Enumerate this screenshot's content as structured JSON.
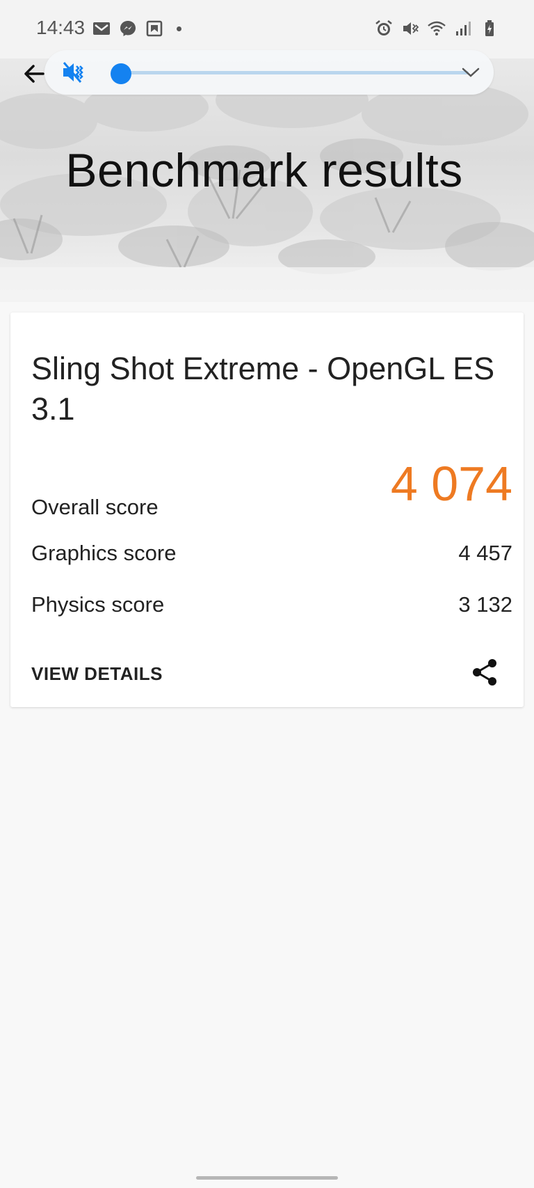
{
  "status_bar": {
    "time": "14:43",
    "left_icons": [
      "gmail-icon",
      "messenger-icon",
      "image-app-icon",
      "more-notifications-dot"
    ],
    "right_icons": [
      "alarm-icon",
      "vibrate-icon",
      "wifi-icon",
      "signal-icon",
      "battery-charging-icon"
    ]
  },
  "volume_panel": {
    "mode_icon": "mute-vibrate-icon",
    "level": 0.02,
    "accent_color": "#1482f0"
  },
  "hero": {
    "title": "Benchmark results"
  },
  "result_card": {
    "title": "Sling Shot Extreme - OpenGL ES 3.1",
    "overall": {
      "label": "Overall score",
      "value": "4 074",
      "color": "#ee7a22"
    },
    "graphics": {
      "label": "Graphics score",
      "value": "4 457"
    },
    "physics": {
      "label": "Physics score",
      "value": "3 132"
    },
    "details_link": "VIEW DETAILS",
    "share_icon": "share-icon"
  }
}
